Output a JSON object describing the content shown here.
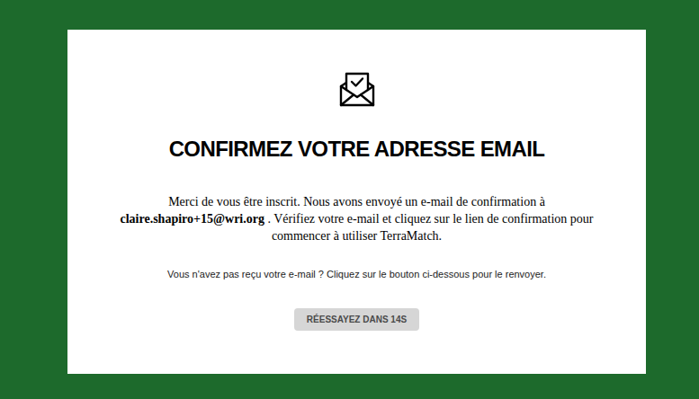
{
  "card": {
    "title": "CONFIRMEZ VOTRE ADRESSE EMAIL",
    "message": {
      "before": "Merci de vous être inscrit. Nous avons envoyé un e-mail de confirmation à ",
      "email": "claire.shapiro+15@wri.org",
      "after": " . Vérifiez votre e-mail et cliquez sur le lien de confirmation pour commencer à utiliser TerraMatch."
    },
    "hint": "Vous n'avez pas reçu votre e-mail ? Cliquez sur le bouton ci-dessous pour le renvoyer.",
    "resend_button": {
      "label": "RÉESSAYEZ DANS 14S",
      "disabled": true
    }
  }
}
